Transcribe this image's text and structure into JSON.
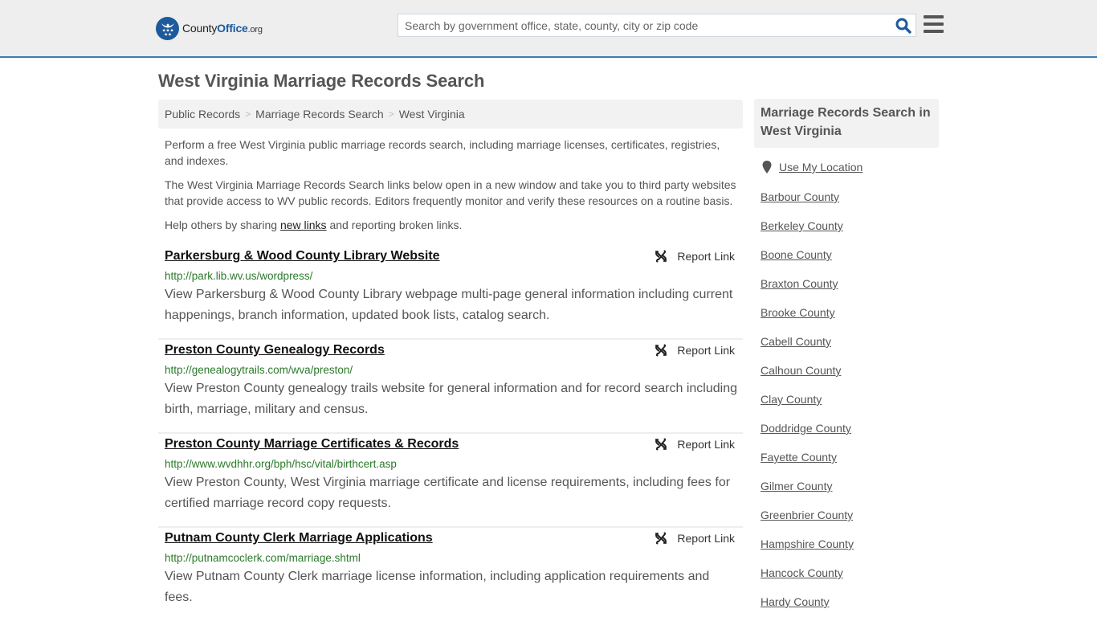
{
  "header": {
    "logo": {
      "name_part1": "County",
      "name_part2": "Office",
      "name_part3": ".org",
      "icon": "eagle-stars-seal-icon"
    },
    "search": {
      "placeholder": "Search by government office, state, county, city or zip code",
      "value": "",
      "icon": "search-icon"
    },
    "menu_icon": "hamburger-menu-icon",
    "accent_color": "#3a7db0",
    "brand_color": "#1c5a9c"
  },
  "page": {
    "title": "West Virginia Marriage Records Search",
    "breadcrumb": [
      "Public Records",
      "Marriage Records Search",
      "West Virginia"
    ],
    "intro": {
      "p1": "Perform a free West Virginia public marriage records search, including marriage licenses, certificates, registries, and indexes.",
      "p2": "The West Virginia Marriage Records Search links below open in a new window and take you to third party websites that provide access to WV public records. Editors frequently monitor and verify these resources on a routine basis.",
      "p3_before": "Help others by sharing ",
      "p3_link": "new links",
      "p3_after": " and reporting broken links."
    }
  },
  "results": [
    {
      "title": "Parkersburg & Wood County Library Website",
      "url": "http://park.lib.wv.us/wordpress/",
      "description": "View Parkersburg & Wood County Library webpage multi-page general information including current happenings, branch information, updated book lists, catalog search.",
      "report_label": "Report Link"
    },
    {
      "title": "Preston County Genealogy Records",
      "url": "http://genealogytrails.com/wva/preston/",
      "description": "View Preston County genealogy trails website for general information and for record search including birth, marriage, military and census.",
      "report_label": "Report Link"
    },
    {
      "title": "Preston County Marriage Certificates & Records",
      "url": "http://www.wvdhhr.org/bph/hsc/vital/birthcert.asp",
      "description": "View Preston County, West Virginia marriage certificate and license requirements, including fees for certified marriage record copy requests.",
      "report_label": "Report Link"
    },
    {
      "title": "Putnam County Clerk Marriage Applications",
      "url": "http://putnamcoclerk.com/marriage.shtml",
      "description": "View Putnam County Clerk marriage license information, including application requirements and fees.",
      "report_label": "Report Link"
    }
  ],
  "sidebar": {
    "title": "Marriage Records Search in West Virginia",
    "use_location": "Use My Location",
    "counties": [
      "Barbour County",
      "Berkeley County",
      "Boone County",
      "Braxton County",
      "Brooke County",
      "Cabell County",
      "Calhoun County",
      "Clay County",
      "Doddridge County",
      "Fayette County",
      "Gilmer County",
      "Greenbrier County",
      "Hampshire County",
      "Hancock County",
      "Hardy County"
    ]
  }
}
